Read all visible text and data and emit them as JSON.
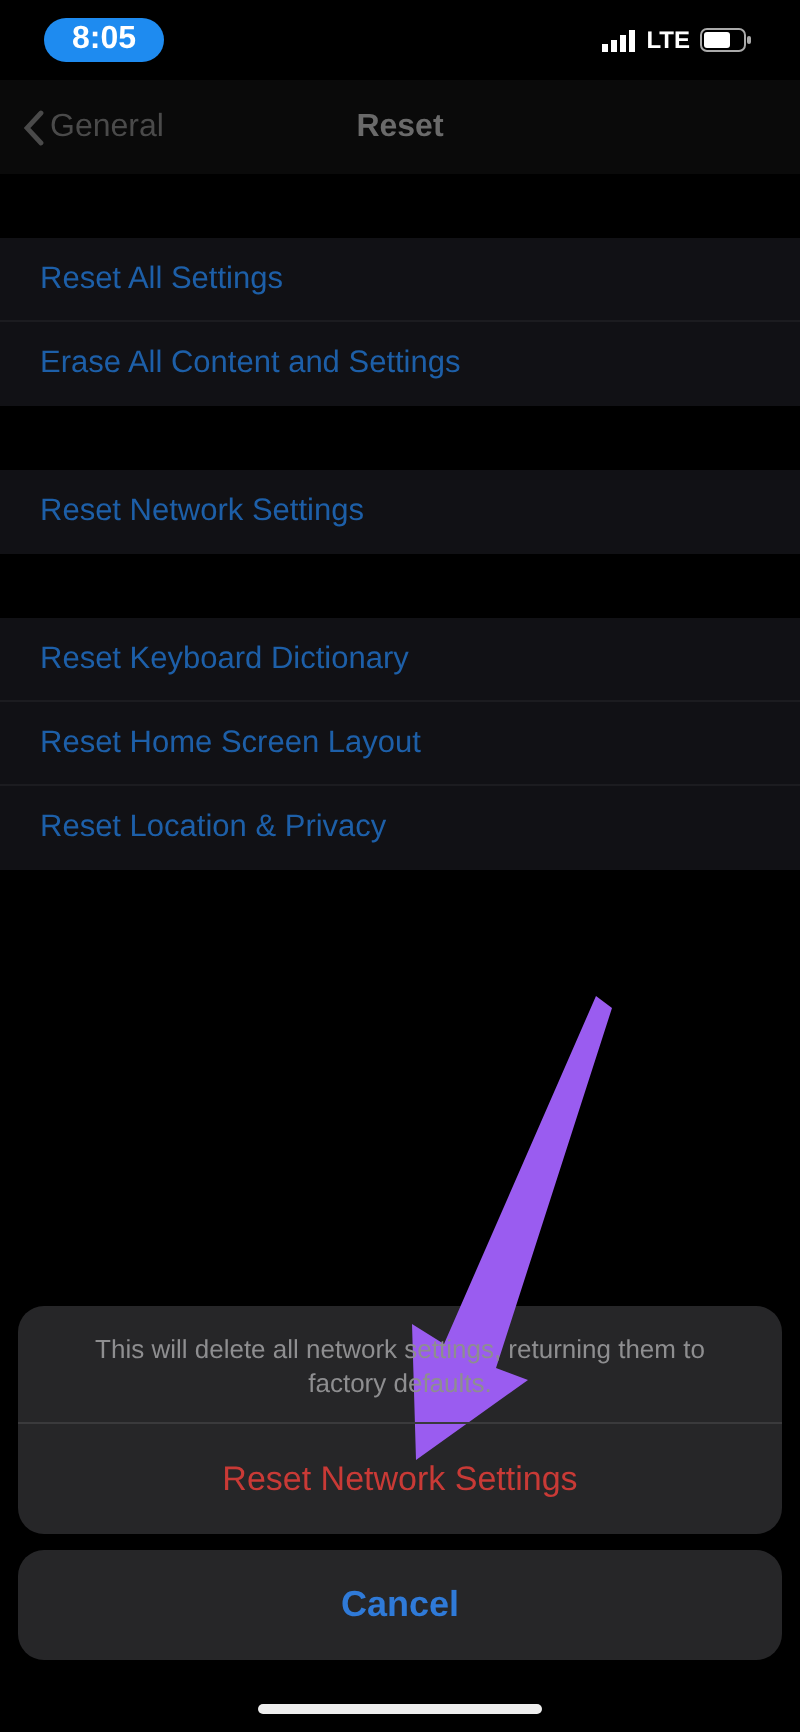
{
  "status_bar": {
    "time": "8:05",
    "network": "LTE"
  },
  "nav": {
    "back": "General",
    "title": "Reset"
  },
  "groups": [
    {
      "items": [
        "Reset All Settings",
        "Erase All Content and Settings"
      ]
    },
    {
      "items": [
        "Reset Network Settings"
      ]
    },
    {
      "items": [
        "Reset Keyboard Dictionary",
        "Reset Home Screen Layout",
        "Reset Location & Privacy"
      ]
    }
  ],
  "action_sheet": {
    "message": "This will delete all network settings, returning them to factory defaults.",
    "actions": [
      {
        "label": "Reset Network Settings",
        "kind": "destructive"
      }
    ],
    "cancel": "Cancel"
  }
}
